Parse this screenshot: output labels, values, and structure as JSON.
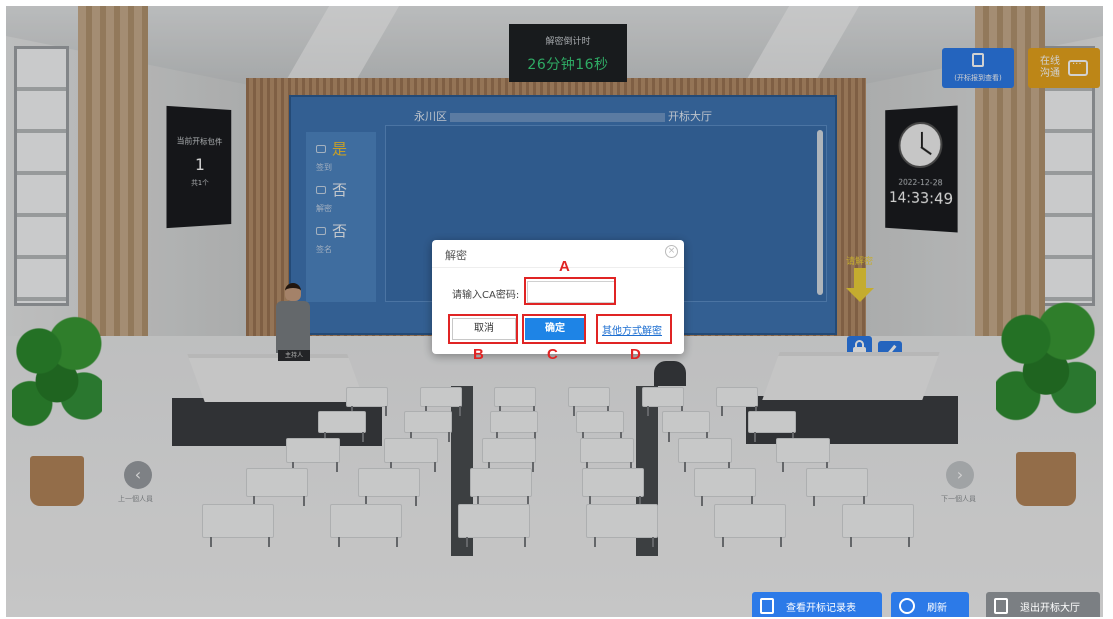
{
  "countdown": {
    "label": "解密倒计时",
    "value": "26分钟16秒"
  },
  "screen": {
    "title_prefix": "永川区",
    "title_suffix": "开标大厅",
    "status": [
      {
        "value": "是",
        "label": "签到"
      },
      {
        "value": "否",
        "label": "解密"
      },
      {
        "value": "否",
        "label": "签名"
      }
    ]
  },
  "left_panel": {
    "title": "当前开标包件",
    "count": "1",
    "total": "共1个"
  },
  "clock": {
    "date": "2022-12-28",
    "time": "14:33:49"
  },
  "top_right": {
    "record_label": "(开标报到查看)",
    "chat_label": "在线沟通"
  },
  "decrypt_hint": "请解密",
  "presenter_tag": "主持人",
  "nav": {
    "prev_label": "上一個人員",
    "next_label": "下一個人員"
  },
  "bottom": {
    "view_record": "查看开标记录表",
    "refresh": "刷新",
    "exit": "退出开标大厅"
  },
  "dialog": {
    "title": "解密",
    "field_label": "请输入CA密码:",
    "password_value": "",
    "cancel": "取消",
    "confirm": "确定",
    "other": "其他方式解密"
  },
  "annotations": {
    "a": "A",
    "b": "B",
    "c": "C",
    "d": "D"
  },
  "colors": {
    "accent": "#2c7ae8",
    "annotation": "#e02424",
    "countdown": "#39d07a",
    "yes": "#f2c230"
  }
}
